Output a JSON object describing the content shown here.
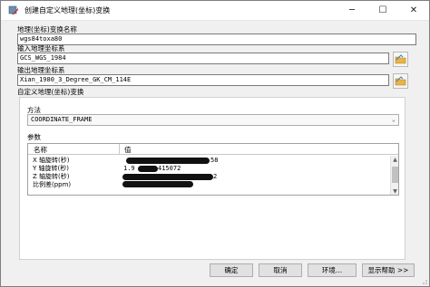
{
  "window": {
    "title": "创建自定义地理(坐标)变换",
    "min_glyph": "─",
    "max_glyph": "☐",
    "close_glyph": "✕"
  },
  "form": {
    "name_label": "地理(坐标)变换名称",
    "name_value": "wgs84toxa80",
    "input_cs_label": "输入地理坐标系",
    "input_cs_value": "GCS_WGS_1984",
    "output_cs_label": "输出地理坐标系",
    "output_cs_value": "Xian_1980_3_Degree_GK_CM_114E",
    "transform_label": "自定义地理(坐标)变换"
  },
  "method": {
    "label": "方法",
    "selected": "COORDINATE_FRAME",
    "arrow": "⌄"
  },
  "params": {
    "label": "参数",
    "col_name": "名称",
    "col_value": "值",
    "rows": [
      {
        "name": "X 轴旋转(秒)",
        "value": "",
        "suffix": "58"
      },
      {
        "name": "Y 轴旋转(秒)",
        "value": "1.9",
        "suffix": "415072"
      },
      {
        "name": "Z 轴旋转(秒)",
        "value": "",
        "suffix": "2"
      },
      {
        "name": "比例差(ppm)",
        "value": "",
        "suffix": ""
      }
    ]
  },
  "buttons": {
    "ok": "确定",
    "cancel": "取消",
    "environments": "环境...",
    "show_help": "显示帮助 >>"
  },
  "colors": {
    "accent": "#3c7fb1",
    "folder": "#e8b448"
  }
}
